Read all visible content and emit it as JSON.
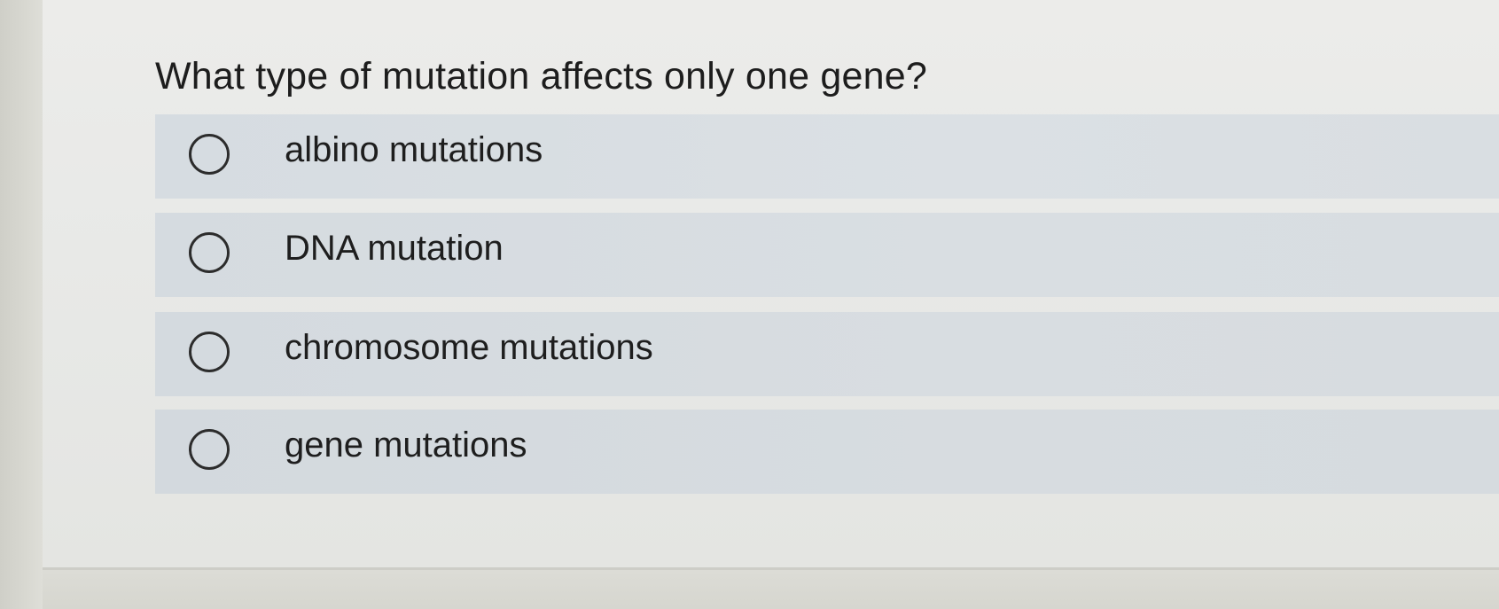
{
  "question": {
    "text": "What type of mutation affects only one gene?"
  },
  "options": [
    {
      "label": "albino mutations",
      "selected": false
    },
    {
      "label": "DNA mutation",
      "selected": false
    },
    {
      "label": "chromosome mutations",
      "selected": false
    },
    {
      "label": "gene mutations",
      "selected": false
    }
  ],
  "colors": {
    "option_background": "#d8dde2",
    "page_background": "#ececea",
    "text": "#1d1d1d"
  }
}
